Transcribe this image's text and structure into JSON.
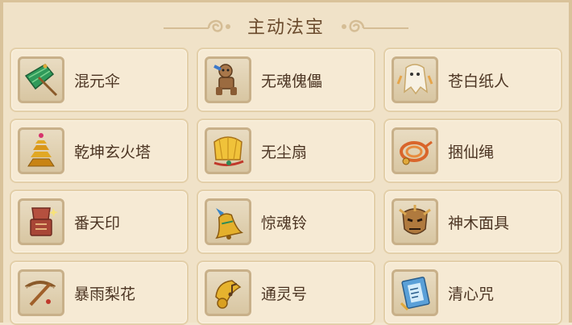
{
  "panel": {
    "title": "主动法宝"
  },
  "items": [
    {
      "label": "混元伞",
      "icon": "umbrella-icon"
    },
    {
      "label": "无魂傀儡",
      "icon": "puppet-icon"
    },
    {
      "label": "苍白纸人",
      "icon": "paper-ghost-icon"
    },
    {
      "label": "乾坤玄火塔",
      "icon": "pagoda-icon"
    },
    {
      "label": "无尘扇",
      "icon": "fan-icon"
    },
    {
      "label": "捆仙绳",
      "icon": "rope-icon"
    },
    {
      "label": "番天印",
      "icon": "seal-icon"
    },
    {
      "label": "惊魂铃",
      "icon": "bell-icon"
    },
    {
      "label": "神木面具",
      "icon": "mask-icon"
    },
    {
      "label": "暴雨梨花",
      "icon": "crossbow-icon"
    },
    {
      "label": "通灵号",
      "icon": "horn-icon"
    },
    {
      "label": "清心咒",
      "icon": "scroll-book-icon"
    }
  ]
}
